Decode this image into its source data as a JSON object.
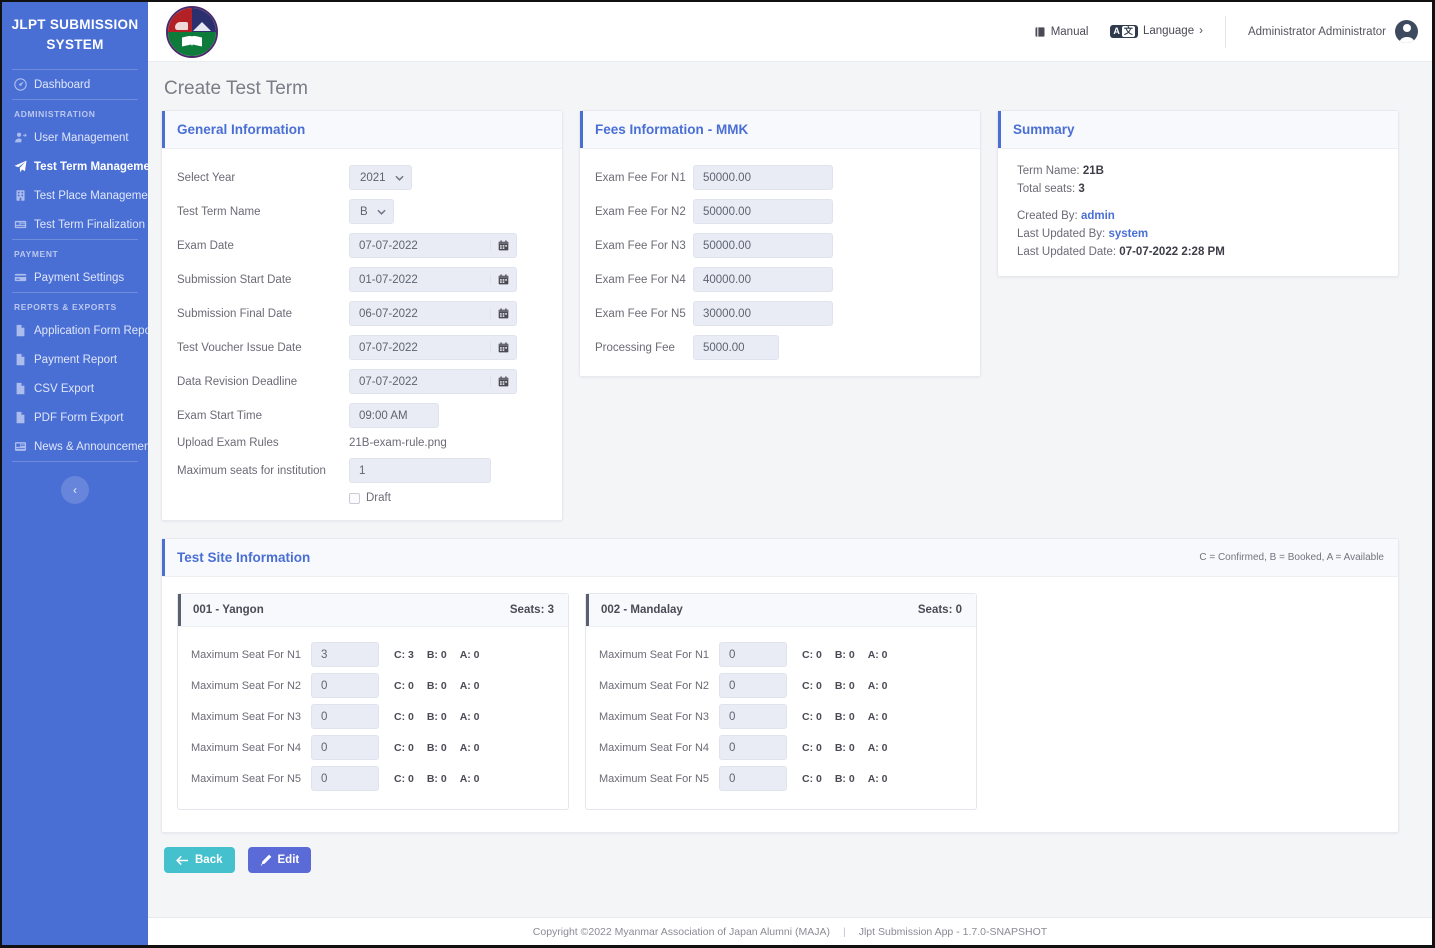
{
  "sidebar": {
    "brand": "JLPT SUBMISSION SYSTEM",
    "items": [
      {
        "label": "Dashboard",
        "icon": "dashboard-icon",
        "active": false
      },
      {
        "label": "User Management",
        "icon": "user-icon",
        "active": false
      },
      {
        "label": "Test Term Management",
        "icon": "paper-plane-icon",
        "active": true
      },
      {
        "label": "Test Place Management",
        "icon": "building-icon",
        "active": false
      },
      {
        "label": "Test Term Finalization",
        "icon": "card-icon",
        "active": false
      },
      {
        "label": "Payment Settings",
        "icon": "credit-card-icon",
        "active": false
      },
      {
        "label": "Application Form Report",
        "icon": "file-icon",
        "active": false
      },
      {
        "label": "Payment Report",
        "icon": "file-icon",
        "active": false
      },
      {
        "label": "CSV Export",
        "icon": "file-icon",
        "active": false
      },
      {
        "label": "PDF Form Export",
        "icon": "file-icon",
        "active": false
      },
      {
        "label": "News & Announcement",
        "icon": "news-icon",
        "active": false
      }
    ],
    "section_administration": "ADMINISTRATION",
    "section_payment": "PAYMENT",
    "section_reports": "REPORTS & EXPORTS",
    "collapse_label": "‹"
  },
  "topbar": {
    "manual_label": "Manual",
    "language_label": "Language",
    "language_badge_a": "A",
    "language_badge_b": "文",
    "language_chevron": "›",
    "user_name": "Administrator Administrator"
  },
  "page": {
    "title": "Create Test Term"
  },
  "general_information": {
    "title": "General Information",
    "select_year": {
      "label": "Select Year",
      "value": "2021"
    },
    "test_term_name": {
      "label": "Test Term Name",
      "value": "B"
    },
    "exam_date": {
      "label": "Exam Date",
      "value": "07-07-2022"
    },
    "submission_start_date": {
      "label": "Submission Start Date",
      "value": "01-07-2022"
    },
    "submission_final_date": {
      "label": "Submission Final Date",
      "value": "06-07-2022"
    },
    "test_voucher_issue_date": {
      "label": "Test Voucher Issue Date",
      "value": "07-07-2022"
    },
    "data_revision_deadline": {
      "label": "Data Revision Deadline",
      "value": "07-07-2022"
    },
    "exam_start_time": {
      "label": "Exam Start Time",
      "value": "09:00 AM"
    },
    "upload_exam_rules": {
      "label": "Upload Exam Rules",
      "value": "21B-exam-rule.png"
    },
    "maximum_seats": {
      "label": "Maximum seats for institution",
      "value": "1"
    },
    "draft": {
      "label": "Draft",
      "checked": false
    }
  },
  "fees_information": {
    "title": "Fees Information",
    "title_suffix": "- MMK",
    "rows": [
      {
        "label": "Exam Fee For N1",
        "value": "50000.00"
      },
      {
        "label": "Exam Fee For N2",
        "value": "50000.00"
      },
      {
        "label": "Exam Fee For N3",
        "value": "50000.00"
      },
      {
        "label": "Exam Fee For N4",
        "value": "40000.00"
      },
      {
        "label": "Exam Fee For N5",
        "value": "30000.00"
      }
    ],
    "processing_fee": {
      "label": "Processing Fee",
      "value": "5000.00"
    }
  },
  "summary": {
    "title": "Summary",
    "term_name_label": "Term Name:",
    "term_name_value": "21B",
    "total_seats_label": "Total seats:",
    "total_seats_value": "3",
    "created_by_label": "Created By:",
    "created_by_value": "admin",
    "last_updated_by_label": "Last Updated By:",
    "last_updated_by_value": "system",
    "last_updated_date_label": "Last Updated Date:",
    "last_updated_date_value": "07-07-2022 2:28 PM"
  },
  "test_site_information": {
    "title": "Test Site Information",
    "legend": "C = Confirmed, B = Booked, A = Available",
    "sites": [
      {
        "name": "001 - Yangon",
        "seats_label": "Seats: 3",
        "rows": [
          {
            "label": "Maximum Seat For N1",
            "value": "3",
            "c": "C: 3",
            "b": "B: 0",
            "a": "A: 0"
          },
          {
            "label": "Maximum Seat For N2",
            "value": "0",
            "c": "C: 0",
            "b": "B: 0",
            "a": "A: 0"
          },
          {
            "label": "Maximum Seat For N3",
            "value": "0",
            "c": "C: 0",
            "b": "B: 0",
            "a": "A: 0"
          },
          {
            "label": "Maximum Seat For N4",
            "value": "0",
            "c": "C: 0",
            "b": "B: 0",
            "a": "A: 0"
          },
          {
            "label": "Maximum Seat For N5",
            "value": "0",
            "c": "C: 0",
            "b": "B: 0",
            "a": "A: 0"
          }
        ]
      },
      {
        "name": "002 - Mandalay",
        "seats_label": "Seats: 0",
        "rows": [
          {
            "label": "Maximum Seat For N1",
            "value": "0",
            "c": "C: 0",
            "b": "B: 0",
            "a": "A: 0"
          },
          {
            "label": "Maximum Seat For N2",
            "value": "0",
            "c": "C: 0",
            "b": "B: 0",
            "a": "A: 0"
          },
          {
            "label": "Maximum Seat For N3",
            "value": "0",
            "c": "C: 0",
            "b": "B: 0",
            "a": "A: 0"
          },
          {
            "label": "Maximum Seat For N4",
            "value": "0",
            "c": "C: 0",
            "b": "B: 0",
            "a": "A: 0"
          },
          {
            "label": "Maximum Seat For N5",
            "value": "0",
            "c": "C: 0",
            "b": "B: 0",
            "a": "A: 0"
          }
        ]
      }
    ]
  },
  "actions": {
    "back_label": "Back",
    "edit_label": "Edit"
  },
  "footer": {
    "copyright": "Copyright ©2022 Myanmar Association of Japan Alumni (MAJA)",
    "separator": "|",
    "app_version": "Jlpt Submission App - 1.7.0-SNAPSHOT"
  },
  "colors": {
    "sidebar": "#4a6fd4",
    "accent": "#4a6fd4",
    "back_button": "#44c1cd",
    "edit_button": "#5a6ad6",
    "page_background": "#f4f5f7"
  }
}
